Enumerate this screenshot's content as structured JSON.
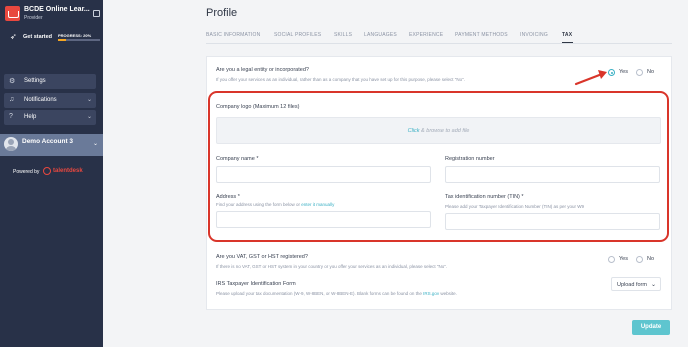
{
  "sidebar": {
    "brand_name": "BCDE Online Lear...",
    "brand_role": "Provider",
    "get_started": "Get started",
    "progress_label": "PROGRESS: 20%",
    "progress": 0.2,
    "settings": "Settings",
    "notifications": "Notifications",
    "help": "Help",
    "account_name": "Demo Account 3",
    "powered_by": "Powered by",
    "powered_brand": "talentdesk"
  },
  "main": {
    "title": "Profile",
    "tabs": [
      "BASIC INFORMATION",
      "SOCIAL PROFILES",
      "SKILLS",
      "LANGUAGES",
      "EXPERIENCE",
      "PAYMENT METHODS",
      "INVOICING",
      "TAX"
    ],
    "active_tab": "TAX"
  },
  "tax_form": {
    "legal_entity_question": "Are you a legal entity or incorporated?",
    "legal_entity_help": "If you offer your services as an individual, rather than as a company that you have set up for this purpose, please select \"No\".",
    "yes": "Yes",
    "no": "No",
    "legal_entity_value": "Yes",
    "company_logo_label": "Company logo (Maximum 12 files)",
    "dropzone_click": "Click",
    "dropzone_rest": " & browse to add file",
    "company_name_label": "Company name *",
    "company_name_value": "",
    "registration_label": "Registration number",
    "registration_value": "",
    "address_label": "Address *",
    "address_help": "Find your address using the form below or ",
    "address_help_link": "enter it manually",
    "address_value": "",
    "tin_label": "Tax identification number (TIN) *",
    "tin_help": "Please add your Taxpayer Identification Number (TIN) as per your W9",
    "tin_value": "",
    "vat_question": "Are you VAT, GST or HST registered?",
    "vat_help": "If there is no VAT, GST or HST system in your country or you offer your services as an individual, please select \"No\".",
    "irs_label": "IRS Taxpayer Identification Form",
    "irs_help": "Please upload your tax documentation (W-9, W-8BEN, or W-8BEN-E). Blank forms can be found on the ",
    "irs_link": "IRS.gov",
    "irs_help_end": " website.",
    "upload_select": "Upload form",
    "update_button": "Update"
  },
  "colors": {
    "sidebar_bg": "#283148",
    "accent": "#3ab0c4",
    "annotation": "#d9352a",
    "brand": "#e8483f"
  }
}
